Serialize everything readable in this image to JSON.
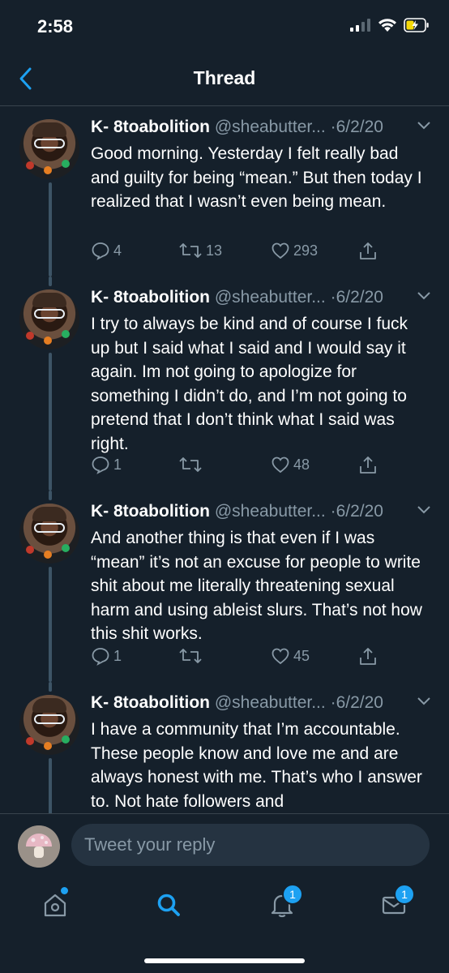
{
  "status_bar": {
    "time": "2:58"
  },
  "nav": {
    "title": "Thread"
  },
  "colors": {
    "background": "#15202b",
    "accent": "#1da1f2",
    "muted": "#8899a6",
    "divider": "#38444d"
  },
  "tweets": [
    {
      "author_name": "K- 8toabolition",
      "handle": "@sheabutter...",
      "date": "6/2/20",
      "text": "Good morning. Yesterday I felt really bad and guilty for being “mean.” But then today I realized that I wasn’t even being mean.",
      "replies": "4",
      "retweets": "13",
      "likes": "293"
    },
    {
      "author_name": "K- 8toabolition",
      "handle": "@sheabutter...",
      "date": "6/2/20",
      "text": "I try to always be kind and of course I fuck up but I said what I said and I would say it again. Im not going to apologize for something I didn’t do, and I’m not going to pretend that I don’t think what I said was right.",
      "replies": "1",
      "retweets": "",
      "likes": "48"
    },
    {
      "author_name": "K- 8toabolition",
      "handle": "@sheabutter...",
      "date": "6/2/20",
      "text": "And another thing is that even if I was “mean” it’s not an excuse for people to write shit about me literally threatening sexual harm and using ableist slurs. That’s not how this shit works.",
      "replies": "1",
      "retweets": "",
      "likes": "45"
    },
    {
      "author_name": "K- 8toabolition",
      "handle": "@sheabutter...",
      "date": "6/2/20",
      "text": "I have a community that I’m accountable. These people know and love me and are always honest with me. That’s who I answer to. Not hate followers and "
    }
  ],
  "reply": {
    "placeholder": "Tweet your reply"
  },
  "tabs": {
    "home_icon": "home-icon",
    "search_icon": "search-icon",
    "notifications_badge": "1",
    "messages_badge": "1"
  }
}
